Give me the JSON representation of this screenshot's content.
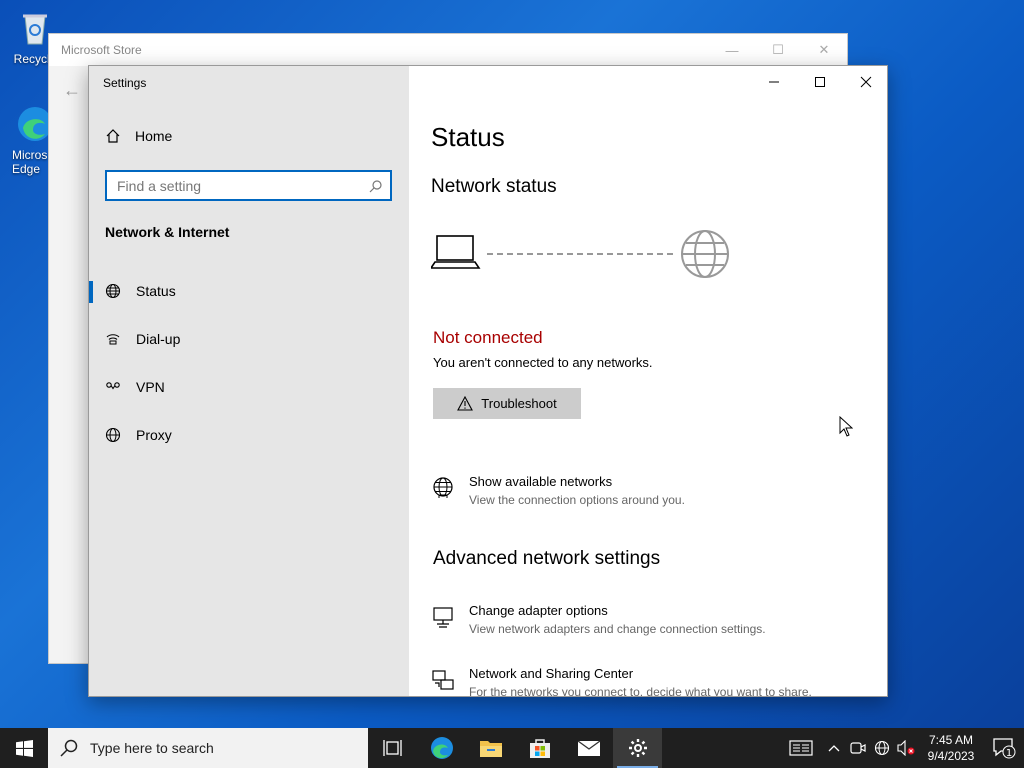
{
  "desktop": {
    "icons": [
      {
        "label": "Recycle"
      },
      {
        "label": "Micros Edge"
      }
    ]
  },
  "store_window": {
    "title": "Microsoft Store"
  },
  "settings_window": {
    "title": "Settings",
    "sidebar": {
      "home_label": "Home",
      "search_placeholder": "Find a setting",
      "section_title": "Network & Internet",
      "items": [
        {
          "label": "Status",
          "icon": "globe-network-icon",
          "active": true
        },
        {
          "label": "Dial-up",
          "icon": "dialup-icon",
          "active": false
        },
        {
          "label": "VPN",
          "icon": "vpn-icon",
          "active": false
        },
        {
          "label": "Proxy",
          "icon": "globe-icon",
          "active": false
        }
      ]
    },
    "main": {
      "page_title": "Status",
      "network_status_heading": "Network status",
      "connection_state": "Not connected",
      "connection_description": "You aren't connected to any networks.",
      "troubleshoot_label": "Troubleshoot",
      "show_networks": {
        "title": "Show available networks",
        "subtitle": "View the connection options around you."
      },
      "advanced_heading": "Advanced network settings",
      "adapter_options": {
        "title": "Change adapter options",
        "subtitle": "View network adapters and change connection settings."
      },
      "sharing_center": {
        "title": "Network and Sharing Center",
        "subtitle": "For the networks you connect to, decide what you want to share."
      }
    },
    "colors": {
      "accent": "#0067c0",
      "error": "#a80000"
    }
  },
  "taskbar": {
    "search_text": "Type here to search",
    "apps": [
      "task-view-icon",
      "edge-icon",
      "file-explorer-icon",
      "store-icon",
      "mail-icon",
      "settings-icon"
    ],
    "clock_time": "7:45 AM",
    "clock_date": "9/4/2023",
    "notification_count": "1"
  }
}
